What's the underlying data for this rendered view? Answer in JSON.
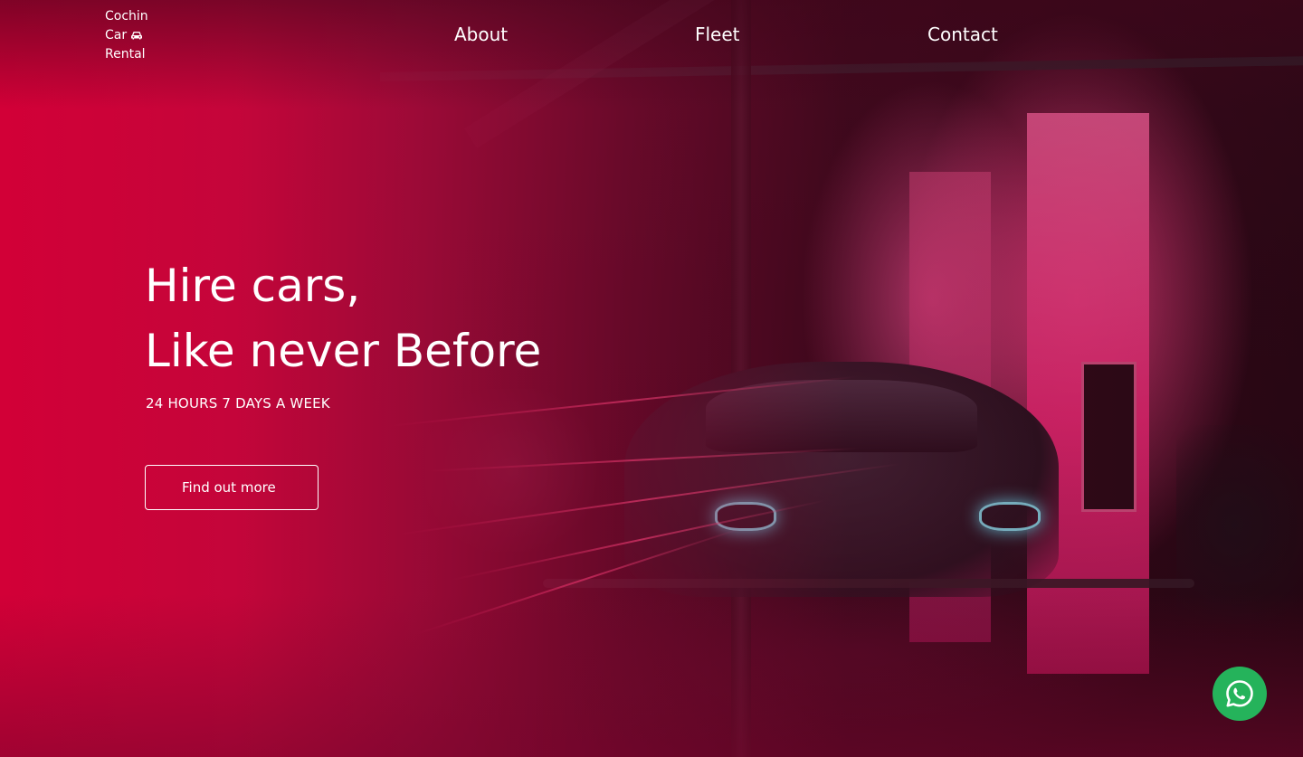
{
  "brand": {
    "line1": "Cochin",
    "line2": "Car",
    "line3": "Rental",
    "icon": "car-icon"
  },
  "nav": {
    "about": "About",
    "fleet": "Fleet",
    "contact": "Contact"
  },
  "hero": {
    "headline_line1": "Hire cars,",
    "headline_line2": "Like never Before",
    "tagline": "24 HOURS 7 DAYS A WEEK",
    "cta_label": "Find out more"
  },
  "floating": {
    "whatsapp_icon": "whatsapp-icon"
  },
  "colors": {
    "overlay_red": "#d20037",
    "whatsapp_green": "#25b35b",
    "text": "#ffffff"
  }
}
